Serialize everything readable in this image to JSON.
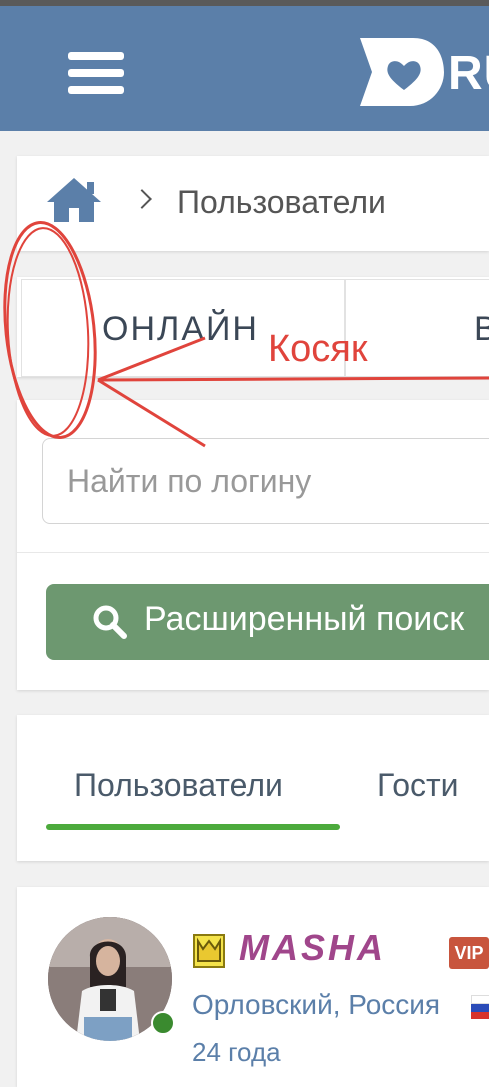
{
  "header": {
    "logo_text": "RU",
    "menu_icon": "hamburger-icon",
    "logo_icon": "heart-logo-icon",
    "color": "#5b7fa9"
  },
  "breadcrumb": {
    "home_icon": "home-icon",
    "separator_icon": "chevron-right-icon",
    "current": "Пользователи"
  },
  "filter_tabs": [
    {
      "label": "ОНЛАЙН"
    },
    {
      "label": "В"
    }
  ],
  "search": {
    "placeholder": "Найти по логину",
    "advanced_label": "Расширенный поиск",
    "button_color": "#6d9870"
  },
  "user_tabs": [
    {
      "label": "Пользователи",
      "active": true
    },
    {
      "label": "Гости",
      "active": false
    }
  ],
  "user": {
    "name": "MASHA",
    "badge": "VIP",
    "location": "Орловский, Россия",
    "age": "24 года",
    "online": true
  },
  "annotation": {
    "text": "Косяк",
    "color": "#e0443c"
  }
}
